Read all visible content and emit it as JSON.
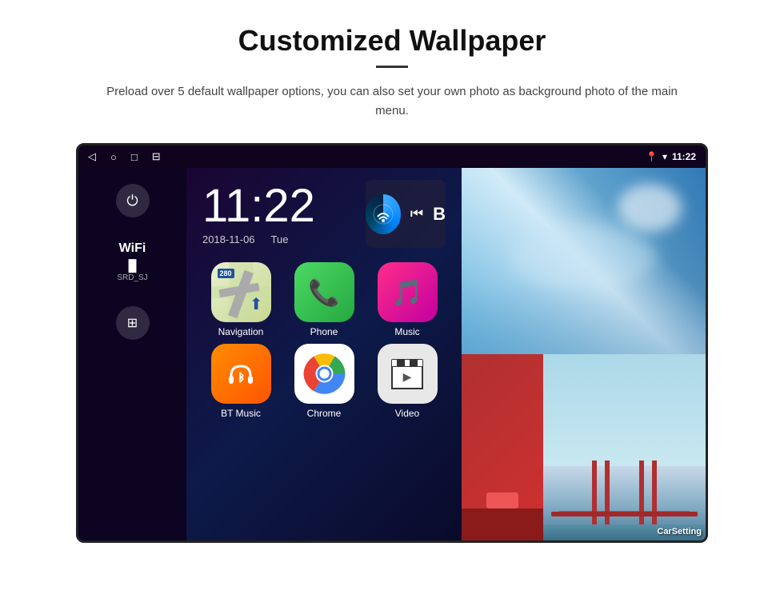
{
  "header": {
    "title": "Customized Wallpaper",
    "subtitle": "Preload over 5 default wallpaper options, you can also set your own photo as background photo of the main menu."
  },
  "statusBar": {
    "time": "11:22",
    "navBack": "◁",
    "navHome": "○",
    "navRecent": "□",
    "navMore": "⊟",
    "locationIcon": "📍",
    "wifiIcon": "▼",
    "time2": "11:22"
  },
  "sidebar": {
    "powerLabel": "⏻",
    "wifi": {
      "title": "WiFi",
      "bars": "▐▌",
      "name": "SRD_SJ"
    },
    "appsLabel": "⊞"
  },
  "clock": {
    "time": "11:22",
    "date": "2018-11-06",
    "day": "Tue"
  },
  "apps": [
    {
      "id": "navigation",
      "label": "Navigation",
      "type": "navigation"
    },
    {
      "id": "phone",
      "label": "Phone",
      "type": "phone"
    },
    {
      "id": "music",
      "label": "Music",
      "type": "music"
    },
    {
      "id": "btmusic",
      "label": "BT Music",
      "type": "btmusic"
    },
    {
      "id": "chrome",
      "label": "Chrome",
      "type": "chrome"
    },
    {
      "id": "video",
      "label": "Video",
      "type": "video"
    }
  ],
  "wallpapers": [
    {
      "id": "ice",
      "description": "Ice cave blue"
    },
    {
      "id": "strip",
      "description": "Red strip"
    },
    {
      "id": "bridge",
      "description": "Golden Gate Bridge",
      "label": "CarSetting"
    }
  ],
  "navBadge": "280"
}
